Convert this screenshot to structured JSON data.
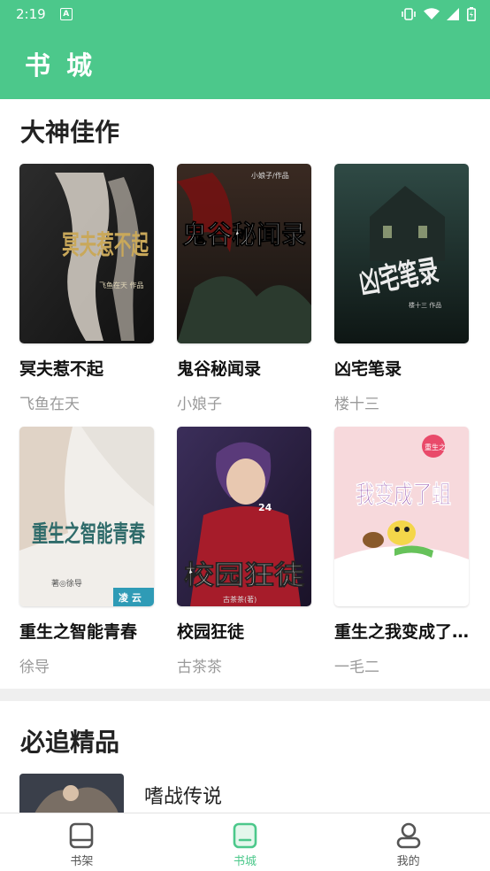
{
  "status_bar": {
    "time": "2:19",
    "notification_icon": "A"
  },
  "app_bar": {
    "title": "书 城"
  },
  "section_featured": {
    "title": "大神佳作",
    "books": [
      {
        "title": "冥夫惹不起",
        "author": "飞鱼在天",
        "cover_text": "冥夫惹不起",
        "cover_sub": "飞鱼在天 作品"
      },
      {
        "title": "鬼谷秘闻录",
        "author": "小娘子",
        "cover_text": "鬼谷秘闻录",
        "cover_sub": "小娘子/作品"
      },
      {
        "title": "凶宅笔录",
        "author": "楼十三",
        "cover_text": "凶宅笔录",
        "cover_sub": "楼十三 作品"
      },
      {
        "title": "重生之智能青春",
        "author": "徐导",
        "cover_text": "重生之智能青春",
        "cover_sub": "著◎徐导",
        "cover_badge": "凌 云"
      },
      {
        "title": "校园狂徒",
        "author": "古茶茶",
        "cover_text": "校园狂徒",
        "cover_sub": "古茶茶(著)",
        "cover_badge": "24"
      },
      {
        "title": "重生之我变成了...",
        "author": "一毛二",
        "cover_text": "我变成了蛆",
        "cover_sub": "重生之"
      }
    ]
  },
  "section_recommended": {
    "title": "必追精品",
    "items": [
      {
        "title": "嗜战传说"
      }
    ]
  },
  "bottom_nav": {
    "items": [
      {
        "label": "书架",
        "icon": "bookshelf-icon"
      },
      {
        "label": "书城",
        "icon": "bookstore-icon",
        "active": true
      },
      {
        "label": "我的",
        "icon": "profile-icon"
      }
    ]
  },
  "colors": {
    "accent": "#4cc88b",
    "text": "#222222",
    "muted": "#9a9a9a",
    "divider": "#efefef"
  }
}
